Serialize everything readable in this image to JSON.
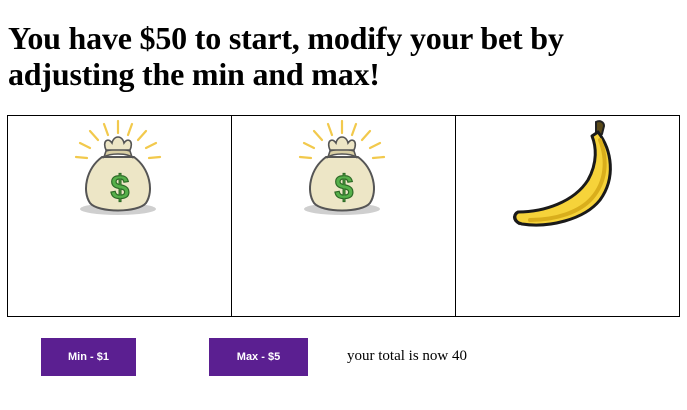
{
  "headline": "You have $50 to start, modify your bet by adjusting the min and max!",
  "reels": [
    {
      "symbol": "money-bag-icon"
    },
    {
      "symbol": "money-bag-icon"
    },
    {
      "symbol": "banana-icon"
    }
  ],
  "buttons": {
    "min_label": "Min - $1",
    "max_label": "Max - $5"
  },
  "status": {
    "total_text": "your total is now 40"
  },
  "colors": {
    "button_bg": "#5b1f91",
    "button_text": "#ffffff",
    "reel_border": "#000000"
  }
}
